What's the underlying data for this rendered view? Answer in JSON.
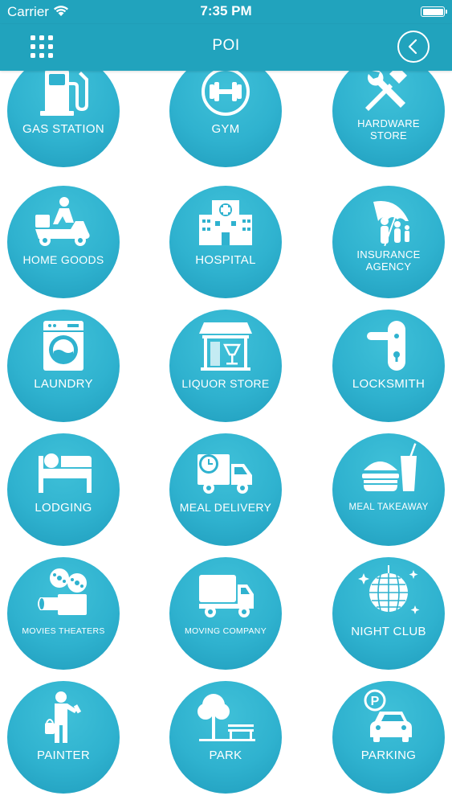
{
  "status_bar": {
    "carrier": "Carrier",
    "time": "7:35 PM"
  },
  "nav": {
    "title": "POI",
    "menu_icon": "grid-menu-icon",
    "back_icon": "chevron-left-circle-icon"
  },
  "pois": [
    {
      "label": "GAS STATION",
      "icon": "gas-pump-icon"
    },
    {
      "label": "GYM",
      "icon": "dumbbell-icon"
    },
    {
      "label": "HARDWARE STORE",
      "icon": "tools-icon"
    },
    {
      "label": "HOME GOODS",
      "icon": "delivery-scooter-icon"
    },
    {
      "label": "HOSPITAL",
      "icon": "hospital-icon"
    },
    {
      "label": "INSURANCE AGENCY",
      "icon": "umbrella-family-icon"
    },
    {
      "label": "LAUNDRY",
      "icon": "washing-machine-icon"
    },
    {
      "label": "LIQUOR STORE",
      "icon": "storefront-glass-icon"
    },
    {
      "label": "LOCKSMITH",
      "icon": "door-handle-icon"
    },
    {
      "label": "LODGING",
      "icon": "bed-icon"
    },
    {
      "label": "MEAL DELIVERY",
      "icon": "delivery-truck-clock-icon"
    },
    {
      "label": "MEAL TAKEAWAY",
      "icon": "burger-drink-icon"
    },
    {
      "label": "MOVIES THEATERS",
      "icon": "film-projector-icon"
    },
    {
      "label": "MOVING COMPANY",
      "icon": "moving-truck-icon"
    },
    {
      "label": "NIGHT CLUB",
      "icon": "disco-ball-icon"
    },
    {
      "label": "PAINTER",
      "icon": "painter-person-icon"
    },
    {
      "label": "PARK",
      "icon": "tree-bench-icon"
    },
    {
      "label": "PARKING",
      "icon": "parking-car-icon"
    }
  ]
}
